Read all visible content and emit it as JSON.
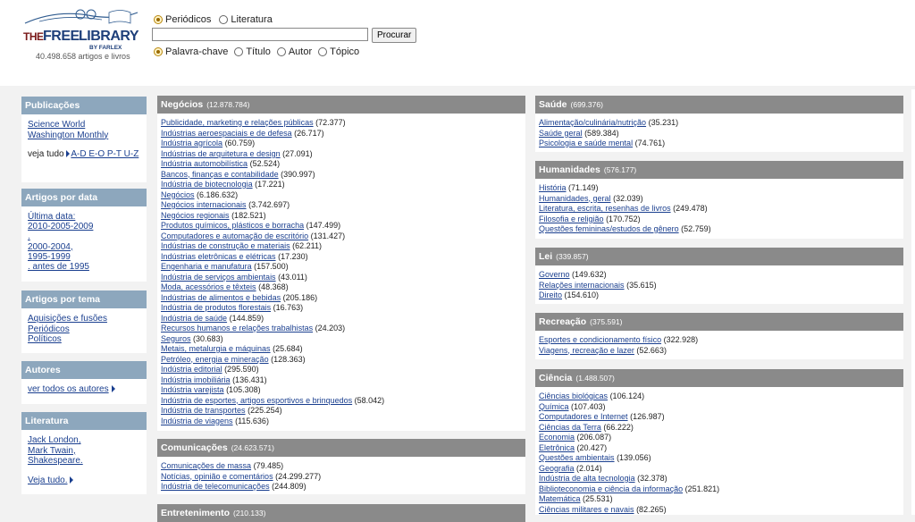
{
  "header": {
    "logo_text": "THEFREELIBRARY",
    "logo_sub": "BY FARLEX",
    "tagline": "40.498.658 artigos e livros"
  },
  "search": {
    "type_options": [
      "Periódicos",
      "Literatura"
    ],
    "type_selected": 0,
    "button": "Procurar",
    "field_options": [
      "Palavra-chave",
      "Título",
      "Autor",
      "Tópico"
    ],
    "field_selected": 0
  },
  "sidebar": {
    "publicacoes": {
      "title": "Publicações",
      "links": [
        "Science World",
        "Washington Monthly"
      ],
      "veja_label": "veja tudo",
      "veja_link": "A-D E-O P-T U-Z"
    },
    "data": {
      "title": "Artigos por data",
      "links": [
        "Última data:",
        "2010-2005-2009",
        ".",
        "2000-2004,",
        "1995-1999",
        ". antes de 1995"
      ]
    },
    "tema": {
      "title": "Artigos por tema",
      "links": [
        "Aquisições e fusões",
        "Periódicos",
        "Políticos"
      ]
    },
    "autores": {
      "title": "Autores",
      "link": "ver todos os autores"
    },
    "literatura": {
      "title": "Literatura",
      "links": [
        "Jack London,",
        "Mark Twain,",
        "Shakespeare."
      ],
      "more": "Veja tudo."
    }
  },
  "negocios": {
    "title": "Negócios",
    "count": "(12.878.784)",
    "items": [
      [
        "Publicidade, marketing e relações públicas",
        "(72.377)"
      ],
      [
        "Indústrias aeroespaciais e de defesa",
        "(26.717)"
      ],
      [
        "Indústria agrícola",
        "(60.759)"
      ],
      [
        "Indústrias de arquitetura e design",
        "(27.091)"
      ],
      [
        "Indústria automobilística",
        "(52.524)"
      ],
      [
        "Bancos, finanças e contabilidade",
        "(390.997)"
      ],
      [
        "Indústria de biotecnologia",
        "(17.221)"
      ],
      [
        "Negócios",
        "(6.186.632)"
      ],
      [
        "Negócios internacionais",
        "(3.742.697)"
      ],
      [
        "Negócios regionais",
        "(182.521)"
      ],
      [
        "Produtos químicos, plásticos e borracha",
        "(147.499)"
      ],
      [
        "Computadores e automação de escritório",
        "(131.427)"
      ],
      [
        "Indústrias de construção e materiais",
        "(62.211)"
      ],
      [
        "Indústrias eletrônicas e elétricas",
        "(17.230)"
      ],
      [
        "Engenharia e manufatura",
        "(157.500)"
      ],
      [
        "Indústria de serviços ambientais",
        "(43.011)"
      ],
      [
        "Moda, acessórios e têxteis",
        "(48.368)"
      ],
      [
        "Indústrias de alimentos e bebidas",
        "(205.186)"
      ],
      [
        "Indústria de produtos florestais",
        "(16.763)"
      ],
      [
        "Indústria de saúde",
        "(144.859)"
      ],
      [
        "Recursos humanos e relações trabalhistas",
        "(24.203)"
      ],
      [
        "Seguros",
        "(30.683)"
      ],
      [
        "Metais, metalurgia e máquinas",
        "(25.684)"
      ],
      [
        "Petróleo, energia e mineração",
        "(128.363)"
      ],
      [
        "Indústria editorial",
        "(295.590)"
      ],
      [
        "Indústria imobiliária",
        "(136.431)"
      ],
      [
        "Indústria varejista",
        "(105.308)"
      ],
      [
        "Indústria de esportes, artigos esportivos e brinquedos",
        "(58.042)"
      ],
      [
        "Indústria de transportes",
        "(225.254)"
      ],
      [
        "Indústria de viagens",
        "(115.636)"
      ]
    ]
  },
  "comunicacoes": {
    "title": "Comunicações",
    "count": "(24.623.571)",
    "items": [
      [
        "Comunicações de massa",
        "(79.485)"
      ],
      [
        "Notícias, opinião e comentários",
        "(24.299.277)"
      ],
      [
        "Indústria de telecomunicações",
        "(244.809)"
      ]
    ]
  },
  "entretenimento": {
    "title": "Entretenimento",
    "count": "(210.133)"
  },
  "saude": {
    "title": "Saúde",
    "count": "(699.376)",
    "items": [
      [
        "Alimentação/culinária/nutrição",
        "(35.231)"
      ],
      [
        "Saúde geral",
        "(589.384)"
      ],
      [
        "Psicologia e saúde mental",
        "(74.761)"
      ]
    ]
  },
  "humanidades": {
    "title": "Humanidades",
    "count": "(576.177)",
    "items": [
      [
        "História",
        "(71.149)"
      ],
      [
        "Humanidades, geral",
        "(32.039)"
      ],
      [
        "Literatura, escrita, resenhas de livros",
        "(249.478)"
      ],
      [
        "Filosofia e religião",
        "(170.752)"
      ],
      [
        "Questões femininas/estudos de gênero",
        "(52.759)"
      ]
    ]
  },
  "lei": {
    "title": "Lei",
    "count": "(339.857)",
    "items": [
      [
        "Governo",
        "(149.632)"
      ],
      [
        "Relações internacionais",
        "(35.615)"
      ],
      [
        "Direito",
        "(154.610)"
      ]
    ]
  },
  "recreacao": {
    "title": "Recreação",
    "count": "(375.591)",
    "items": [
      [
        "Esportes e condicionamento físico",
        "(322.928)"
      ],
      [
        "Viagens, recreação e lazer",
        "(52.663)"
      ]
    ]
  },
  "ciencia": {
    "title": "Ciência",
    "count": "(1.488.507)",
    "items": [
      [
        "Ciências biológicas",
        "(106.124)"
      ],
      [
        "Química",
        "(107.403)"
      ],
      [
        "Computadores e Internet",
        "(126.987)"
      ],
      [
        "Ciências da Terra",
        "(66.222)"
      ],
      [
        "Economia",
        "(206.087)"
      ],
      [
        "Eletrônica",
        "(20.427)"
      ],
      [
        "Questões ambientais",
        "(139.056)"
      ],
      [
        "Geografia",
        "(2.014)"
      ],
      [
        "Indústria de alta tecnologia",
        "(32.378)"
      ],
      [
        "Biblioteconomia e ciência da informação",
        "(251.821)"
      ],
      [
        "Matemática",
        "(25.531)"
      ],
      [
        "Ciências militares e navais",
        "(82.265)"
      ]
    ]
  }
}
